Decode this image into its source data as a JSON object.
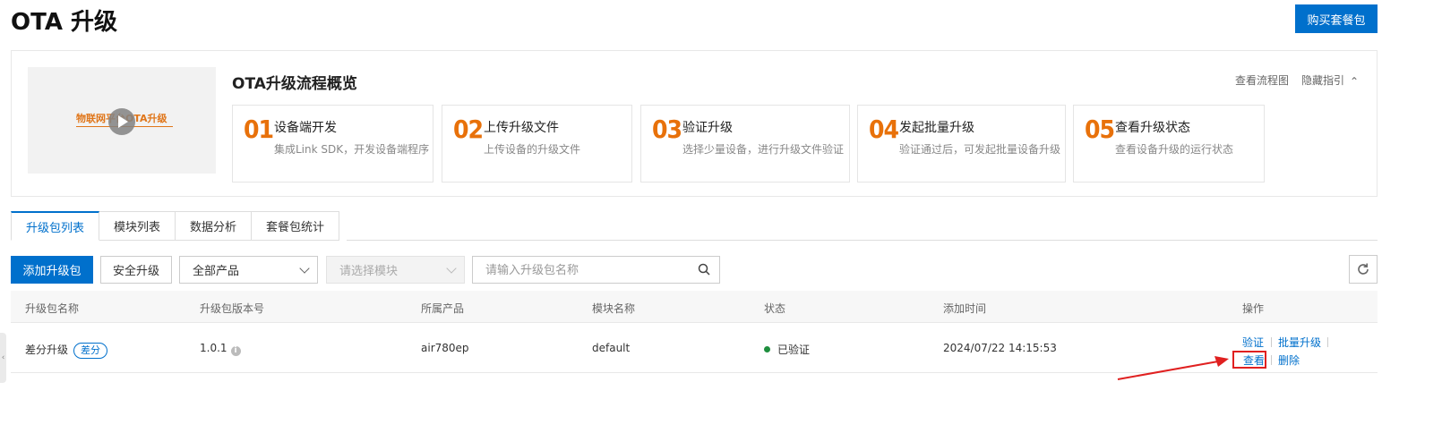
{
  "header": {
    "title": "OTA 升级",
    "buy_button": "购买套餐包"
  },
  "overview": {
    "video_caption": "物联网平台OTA升级",
    "title": "OTA升级流程概览",
    "view_flow": "查看流程图",
    "hide_guide": "隐藏指引",
    "steps": [
      {
        "num": "01",
        "title": "设备端开发",
        "desc": "集成Link SDK，开发设备端程序"
      },
      {
        "num": "02",
        "title": "上传升级文件",
        "desc": "上传设备的升级文件"
      },
      {
        "num": "03",
        "title": "验证升级",
        "desc": "选择少量设备，进行升级文件验证"
      },
      {
        "num": "04",
        "title": "发起批量升级",
        "desc": "验证通过后，可发起批量设备升级"
      },
      {
        "num": "05",
        "title": "查看升级状态",
        "desc": "查看设备升级的运行状态"
      }
    ]
  },
  "tabs": [
    "升级包列表",
    "模块列表",
    "数据分析",
    "套餐包统计"
  ],
  "toolbar": {
    "add_button": "添加升级包",
    "secure_button": "安全升级",
    "product_select": "全部产品",
    "module_select": "请选择模块",
    "search_placeholder": "请输入升级包名称"
  },
  "table": {
    "columns": [
      "升级包名称",
      "升级包版本号",
      "所属产品",
      "模块名称",
      "状态",
      "添加时间",
      "操作"
    ],
    "rows": [
      {
        "name": "差分升级",
        "badge": "差分",
        "version": "1.0.1",
        "product": "air780ep",
        "module": "default",
        "status": "已验证",
        "added": "2024/07/22 14:15:53",
        "actions": [
          "验证",
          "批量升级",
          "查看",
          "删除"
        ]
      }
    ]
  },
  "colors": {
    "primary": "#0070cc",
    "step_number": "#e8710a",
    "status_ok": "#1e8e3e",
    "annotation": "#e02020"
  }
}
